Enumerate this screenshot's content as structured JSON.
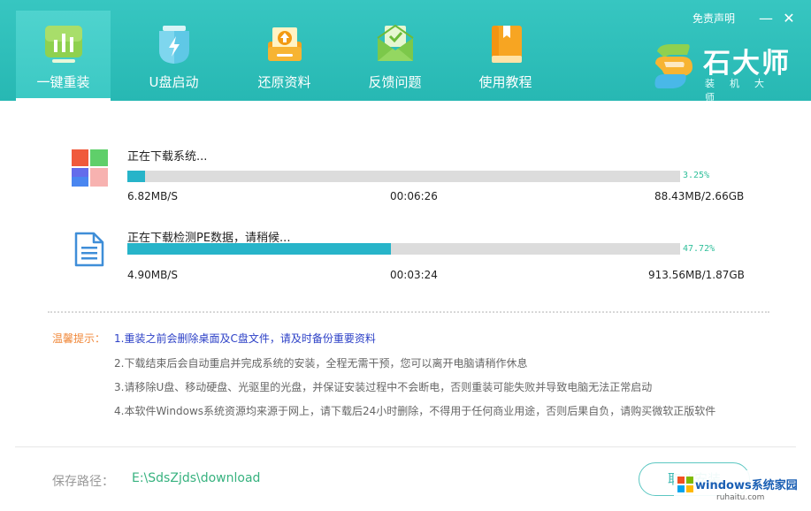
{
  "nav": {
    "items": [
      {
        "label": "一键重装",
        "icon": "reinstall-chart-icon",
        "active": true
      },
      {
        "label": "U盘启动",
        "icon": "usb-boot-icon"
      },
      {
        "label": "还原资料",
        "icon": "restore-data-icon"
      },
      {
        "label": "反馈问题",
        "icon": "feedback-mail-icon"
      },
      {
        "label": "使用教程",
        "icon": "tutorial-book-icon"
      }
    ]
  },
  "header": {
    "disclaimer": "免责声明",
    "minimize": "—",
    "close": "✕"
  },
  "logo": {
    "title": "石大师",
    "subtitle": "装机大师"
  },
  "downloads": [
    {
      "title": "正在下载系统...",
      "progress": 0.0325,
      "percent_text": "3.25%",
      "speed": "6.82MB/S",
      "time": "00:06:26",
      "size": "88.43MB/2.66GB",
      "icon": "windows-logo-icon"
    },
    {
      "title": "正在下载检测PE数据，请稍候...",
      "progress": 0.4772,
      "percent_text": "47.72%",
      "speed": "4.90MB/S",
      "time": "00:03:24",
      "size": "913.56MB/1.87GB",
      "icon": "document-file-icon"
    }
  ],
  "tips": {
    "label": "温馨提示：",
    "items": [
      "1.重装之前会删除桌面及C盘文件，请及时备份重要资料",
      "2.下载结束后会自动重启并完成系统的安装，全程无需干预，您可以离开电脑请稍作休息",
      "3.请移除U盘、移动硬盘、光驱里的光盘，并保证安装过程中不会断电，否则重装可能失败并导致电脑无法正常启动",
      "4.本软件Windows系统资源均来源于网上，请下载后24小时删除，不得用于任何商业用途，否则后果自负，请购买微软正版软件"
    ]
  },
  "footer": {
    "save_label": "保存路径：",
    "save_path": "E:\\SdsZjds\\download",
    "cancel": "取消安装"
  },
  "watermark": {
    "text": "windows系统家园",
    "sub": "ruhaitu.com"
  },
  "colors": {
    "header": "#2fbfba",
    "progress": "#27b4c9",
    "percent": "#2fbf9a",
    "tip_label": "#f0883a",
    "tip_first": "#2d41c7",
    "path": "#37b27f"
  }
}
